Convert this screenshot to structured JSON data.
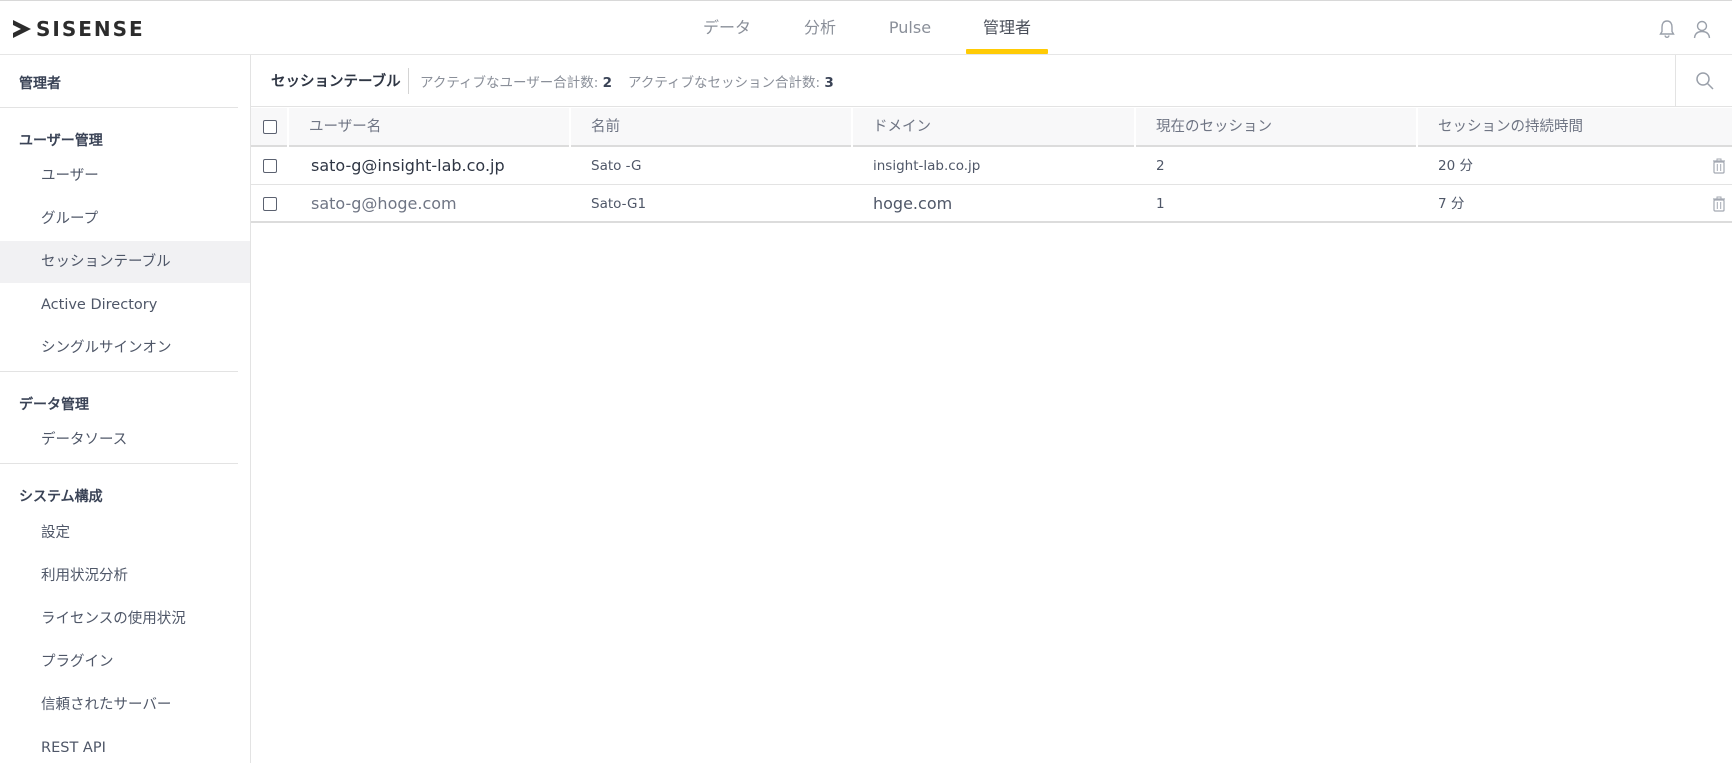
{
  "app": {
    "logo_text": "SISENSE",
    "nav": [
      {
        "label": "データ",
        "active": false
      },
      {
        "label": "分析",
        "active": false
      },
      {
        "label": "Pulse",
        "active": false
      },
      {
        "label": "管理者",
        "active": true
      }
    ],
    "icons": {
      "notifications": "bell-icon",
      "user": "user-icon"
    },
    "accent_color": "#ffcb05"
  },
  "sidebar": {
    "title": "管理者",
    "sections": [
      {
        "header": "ユーザー管理",
        "items": [
          "ユーザー",
          "グループ",
          "セッションテーブル",
          "Active Directory",
          "シングルサインオン"
        ]
      },
      {
        "header": "データ管理",
        "items": [
          "データソース"
        ]
      },
      {
        "header": "システム構成",
        "items": [
          "設定",
          "利用状況分析",
          "ライセンスの使用状況",
          "プラグイン",
          "信頼されたサーバー",
          "REST API"
        ]
      }
    ],
    "active_item": "セッションテーブル"
  },
  "main": {
    "title": "セッションテーブル",
    "active_users_label": "アクティブなユーザー合計数:",
    "active_users_value": "2",
    "active_sessions_label": "アクティブなセッション合計数:",
    "active_sessions_value": "3",
    "table": {
      "columns": [
        "ユーザー名",
        "名前",
        "ドメイン",
        "現在のセッション",
        "セッションの持続時間"
      ],
      "rows": [
        {
          "user": "sato-g@insight-lab.co.jp",
          "name": "Sato -G",
          "domain": "insight-lab.co.jp",
          "sessions": "2",
          "duration": "20 分"
        },
        {
          "user": "sato-g@hoge.com",
          "name": "Sato-G1",
          "domain": "hoge.com",
          "sessions": "1",
          "duration": "7 分"
        }
      ]
    }
  }
}
